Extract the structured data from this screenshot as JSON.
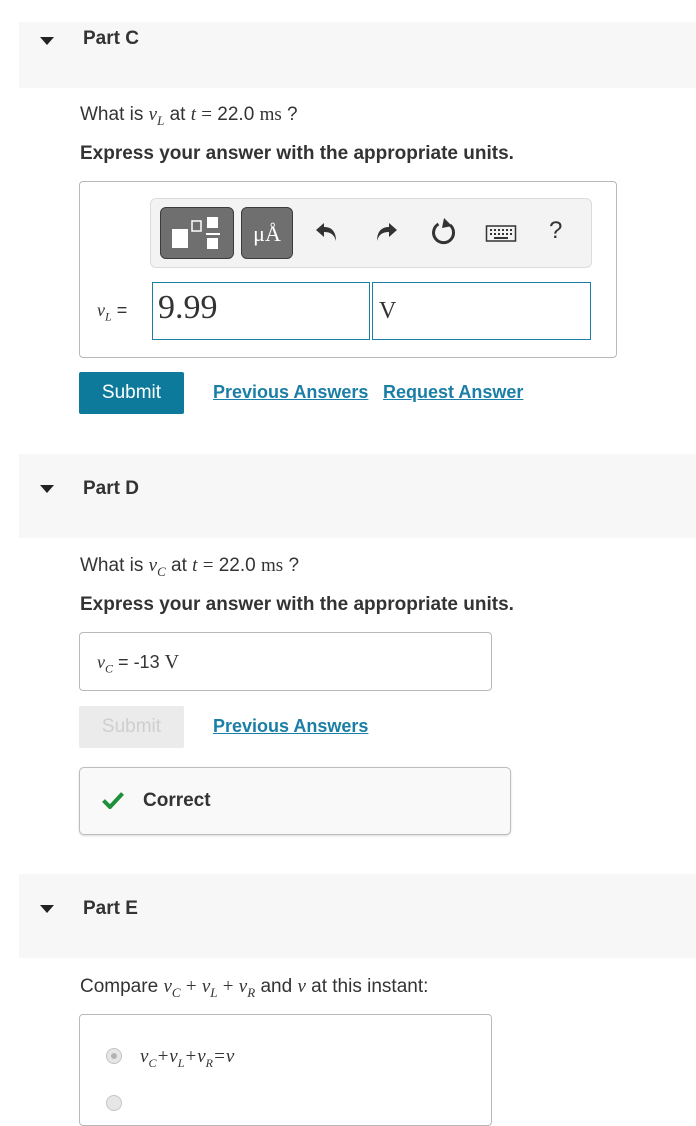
{
  "parts": {
    "c": {
      "title": "Part C",
      "question": {
        "q_what": "What is",
        "var": "v",
        "var_sub": "L",
        "at": "at",
        "t": "t",
        "eq": "=",
        "value": "22.0",
        "unit": "ms",
        "qmark": "?"
      },
      "instruction": "Express your answer with the appropriate units.",
      "toolbar": {
        "units_label": "μÅ",
        "help_label": "?"
      },
      "field_label": {
        "var": "v",
        "sub": "L",
        "eq": "="
      },
      "value_input": "9.99",
      "unit_input": "V",
      "submit_label": "Submit",
      "previous_answers": "Previous Answers",
      "request_answer": "Request Answer"
    },
    "d": {
      "title": "Part D",
      "question": {
        "q_what": "What is",
        "var": "v",
        "var_sub": "C",
        "at": "at",
        "t": "t",
        "eq": "=",
        "value": "22.0",
        "unit": "ms",
        "qmark": "?"
      },
      "instruction": "Express your answer with the appropriate units.",
      "answer": {
        "var": "v",
        "sub": "C",
        "eq": "=",
        "value": "-13",
        "unit": "V"
      },
      "submit_label": "Submit",
      "previous_answers": "Previous Answers",
      "feedback": "Correct"
    },
    "e": {
      "title": "Part E",
      "question": {
        "compare": "Compare",
        "vC": "v",
        "vC_sub": "C",
        "plus1": "+",
        "vL": "v",
        "vL_sub": "L",
        "plus2": "+",
        "vR": "v",
        "vR_sub": "R",
        "and": "and",
        "v": "v",
        "rest": "at this instant:"
      },
      "option1": {
        "a": "v",
        "a_sub": "C",
        "p1": "+",
        "b": "v",
        "b_sub": "L",
        "p2": "+",
        "c": "v",
        "c_sub": "R",
        "eq": "=",
        "d": "v"
      }
    }
  },
  "colors": {
    "accent": "#0d7a9b",
    "link": "#1a7ea6",
    "correct_green": "#1f8f3a",
    "header_bg": "#f7f7f7"
  },
  "icons": [
    "caret-down-icon",
    "templates-icon",
    "units-icon",
    "undo-icon",
    "redo-icon",
    "reset-icon",
    "keyboard-icon",
    "help-icon",
    "checkmark-icon"
  ]
}
